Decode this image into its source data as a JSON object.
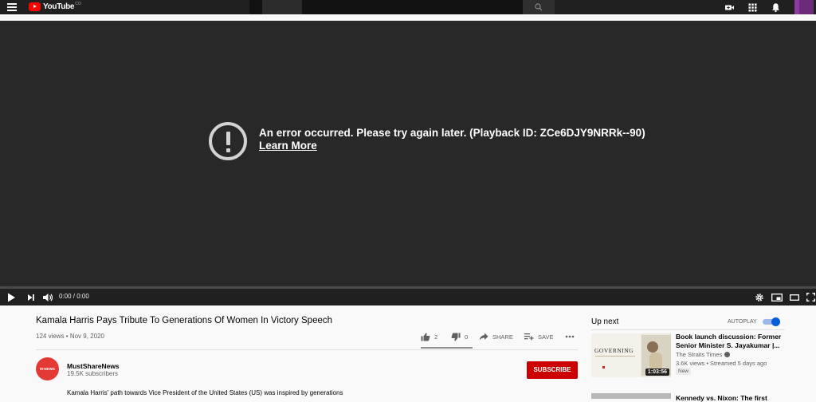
{
  "header": {
    "logo_text": "YouTube",
    "logo_country": "CO"
  },
  "player": {
    "error_message": "An error occurred. Please try again later. (Playback ID: ZCe6DJY9NRRk--90)",
    "error_link": "Learn More",
    "time": "0:00 / 0:00",
    "progress": 0
  },
  "video": {
    "title": "Kamala Harris Pays Tribute To Generations Of Women In Victory Speech",
    "meta": "124 views • Nov 9, 2020",
    "likes": "2",
    "dislikes": "0",
    "share_label": "SHARE",
    "save_label": "SAVE"
  },
  "channel": {
    "avatar_text": "M-NEWS",
    "name": "MustShareNews",
    "subscribers": "19.5K subscribers",
    "subscribe_label": "SUBSCRIBE"
  },
  "description": "Kamala Harris' path towards Vice President of the United States (US) was inspired by generations",
  "sidebar": {
    "up_next": "Up next",
    "autoplay_label": "AUTOPLAY",
    "autoplay_on": true,
    "items": [
      {
        "title": "Book launch discussion: Former Senior Minister S. Jayakumar |...",
        "channel": "The Straits Times",
        "meta": "3.6K views • Streamed 5 days ago",
        "badge": "New",
        "duration": "1:03:56",
        "thumb_text": "GOVERNING"
      },
      {
        "title": "Kennedy vs. Nixon: The first"
      }
    ]
  },
  "colors": {
    "brand_red": "#ff0000",
    "subscribe_red": "#cc0000",
    "toggle_blue": "#065fd4",
    "player_bg": "#282828"
  }
}
